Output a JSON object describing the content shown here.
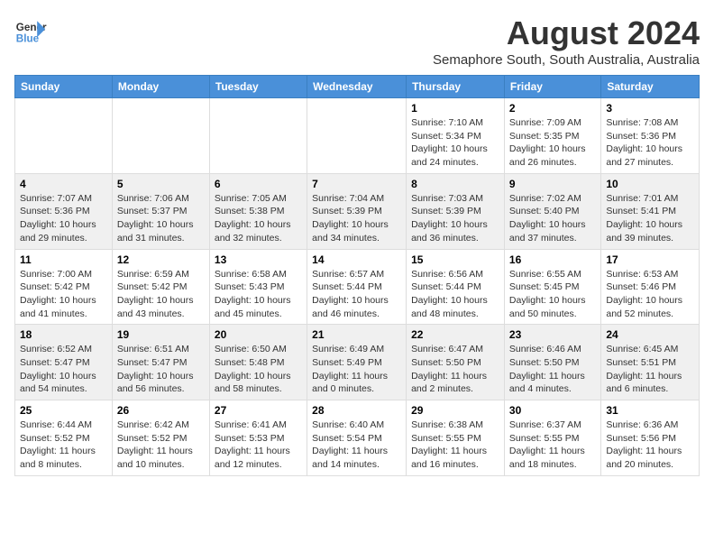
{
  "logo": {
    "general": "General",
    "blue": "Blue"
  },
  "title": "August 2024",
  "subtitle": "Semaphore South, South Australia, Australia",
  "weekdays": [
    "Sunday",
    "Monday",
    "Tuesday",
    "Wednesday",
    "Thursday",
    "Friday",
    "Saturday"
  ],
  "weeks": [
    [
      {
        "day": "",
        "info": ""
      },
      {
        "day": "",
        "info": ""
      },
      {
        "day": "",
        "info": ""
      },
      {
        "day": "",
        "info": ""
      },
      {
        "day": "1",
        "info": "Sunrise: 7:10 AM\nSunset: 5:34 PM\nDaylight: 10 hours\nand 24 minutes."
      },
      {
        "day": "2",
        "info": "Sunrise: 7:09 AM\nSunset: 5:35 PM\nDaylight: 10 hours\nand 26 minutes."
      },
      {
        "day": "3",
        "info": "Sunrise: 7:08 AM\nSunset: 5:36 PM\nDaylight: 10 hours\nand 27 minutes."
      }
    ],
    [
      {
        "day": "4",
        "info": "Sunrise: 7:07 AM\nSunset: 5:36 PM\nDaylight: 10 hours\nand 29 minutes."
      },
      {
        "day": "5",
        "info": "Sunrise: 7:06 AM\nSunset: 5:37 PM\nDaylight: 10 hours\nand 31 minutes."
      },
      {
        "day": "6",
        "info": "Sunrise: 7:05 AM\nSunset: 5:38 PM\nDaylight: 10 hours\nand 32 minutes."
      },
      {
        "day": "7",
        "info": "Sunrise: 7:04 AM\nSunset: 5:39 PM\nDaylight: 10 hours\nand 34 minutes."
      },
      {
        "day": "8",
        "info": "Sunrise: 7:03 AM\nSunset: 5:39 PM\nDaylight: 10 hours\nand 36 minutes."
      },
      {
        "day": "9",
        "info": "Sunrise: 7:02 AM\nSunset: 5:40 PM\nDaylight: 10 hours\nand 37 minutes."
      },
      {
        "day": "10",
        "info": "Sunrise: 7:01 AM\nSunset: 5:41 PM\nDaylight: 10 hours\nand 39 minutes."
      }
    ],
    [
      {
        "day": "11",
        "info": "Sunrise: 7:00 AM\nSunset: 5:42 PM\nDaylight: 10 hours\nand 41 minutes."
      },
      {
        "day": "12",
        "info": "Sunrise: 6:59 AM\nSunset: 5:42 PM\nDaylight: 10 hours\nand 43 minutes."
      },
      {
        "day": "13",
        "info": "Sunrise: 6:58 AM\nSunset: 5:43 PM\nDaylight: 10 hours\nand 45 minutes."
      },
      {
        "day": "14",
        "info": "Sunrise: 6:57 AM\nSunset: 5:44 PM\nDaylight: 10 hours\nand 46 minutes."
      },
      {
        "day": "15",
        "info": "Sunrise: 6:56 AM\nSunset: 5:44 PM\nDaylight: 10 hours\nand 48 minutes."
      },
      {
        "day": "16",
        "info": "Sunrise: 6:55 AM\nSunset: 5:45 PM\nDaylight: 10 hours\nand 50 minutes."
      },
      {
        "day": "17",
        "info": "Sunrise: 6:53 AM\nSunset: 5:46 PM\nDaylight: 10 hours\nand 52 minutes."
      }
    ],
    [
      {
        "day": "18",
        "info": "Sunrise: 6:52 AM\nSunset: 5:47 PM\nDaylight: 10 hours\nand 54 minutes."
      },
      {
        "day": "19",
        "info": "Sunrise: 6:51 AM\nSunset: 5:47 PM\nDaylight: 10 hours\nand 56 minutes."
      },
      {
        "day": "20",
        "info": "Sunrise: 6:50 AM\nSunset: 5:48 PM\nDaylight: 10 hours\nand 58 minutes."
      },
      {
        "day": "21",
        "info": "Sunrise: 6:49 AM\nSunset: 5:49 PM\nDaylight: 11 hours\nand 0 minutes."
      },
      {
        "day": "22",
        "info": "Sunrise: 6:47 AM\nSunset: 5:50 PM\nDaylight: 11 hours\nand 2 minutes."
      },
      {
        "day": "23",
        "info": "Sunrise: 6:46 AM\nSunset: 5:50 PM\nDaylight: 11 hours\nand 4 minutes."
      },
      {
        "day": "24",
        "info": "Sunrise: 6:45 AM\nSunset: 5:51 PM\nDaylight: 11 hours\nand 6 minutes."
      }
    ],
    [
      {
        "day": "25",
        "info": "Sunrise: 6:44 AM\nSunset: 5:52 PM\nDaylight: 11 hours\nand 8 minutes."
      },
      {
        "day": "26",
        "info": "Sunrise: 6:42 AM\nSunset: 5:52 PM\nDaylight: 11 hours\nand 10 minutes."
      },
      {
        "day": "27",
        "info": "Sunrise: 6:41 AM\nSunset: 5:53 PM\nDaylight: 11 hours\nand 12 minutes."
      },
      {
        "day": "28",
        "info": "Sunrise: 6:40 AM\nSunset: 5:54 PM\nDaylight: 11 hours\nand 14 minutes."
      },
      {
        "day": "29",
        "info": "Sunrise: 6:38 AM\nSunset: 5:55 PM\nDaylight: 11 hours\nand 16 minutes."
      },
      {
        "day": "30",
        "info": "Sunrise: 6:37 AM\nSunset: 5:55 PM\nDaylight: 11 hours\nand 18 minutes."
      },
      {
        "day": "31",
        "info": "Sunrise: 6:36 AM\nSunset: 5:56 PM\nDaylight: 11 hours\nand 20 minutes."
      }
    ]
  ]
}
